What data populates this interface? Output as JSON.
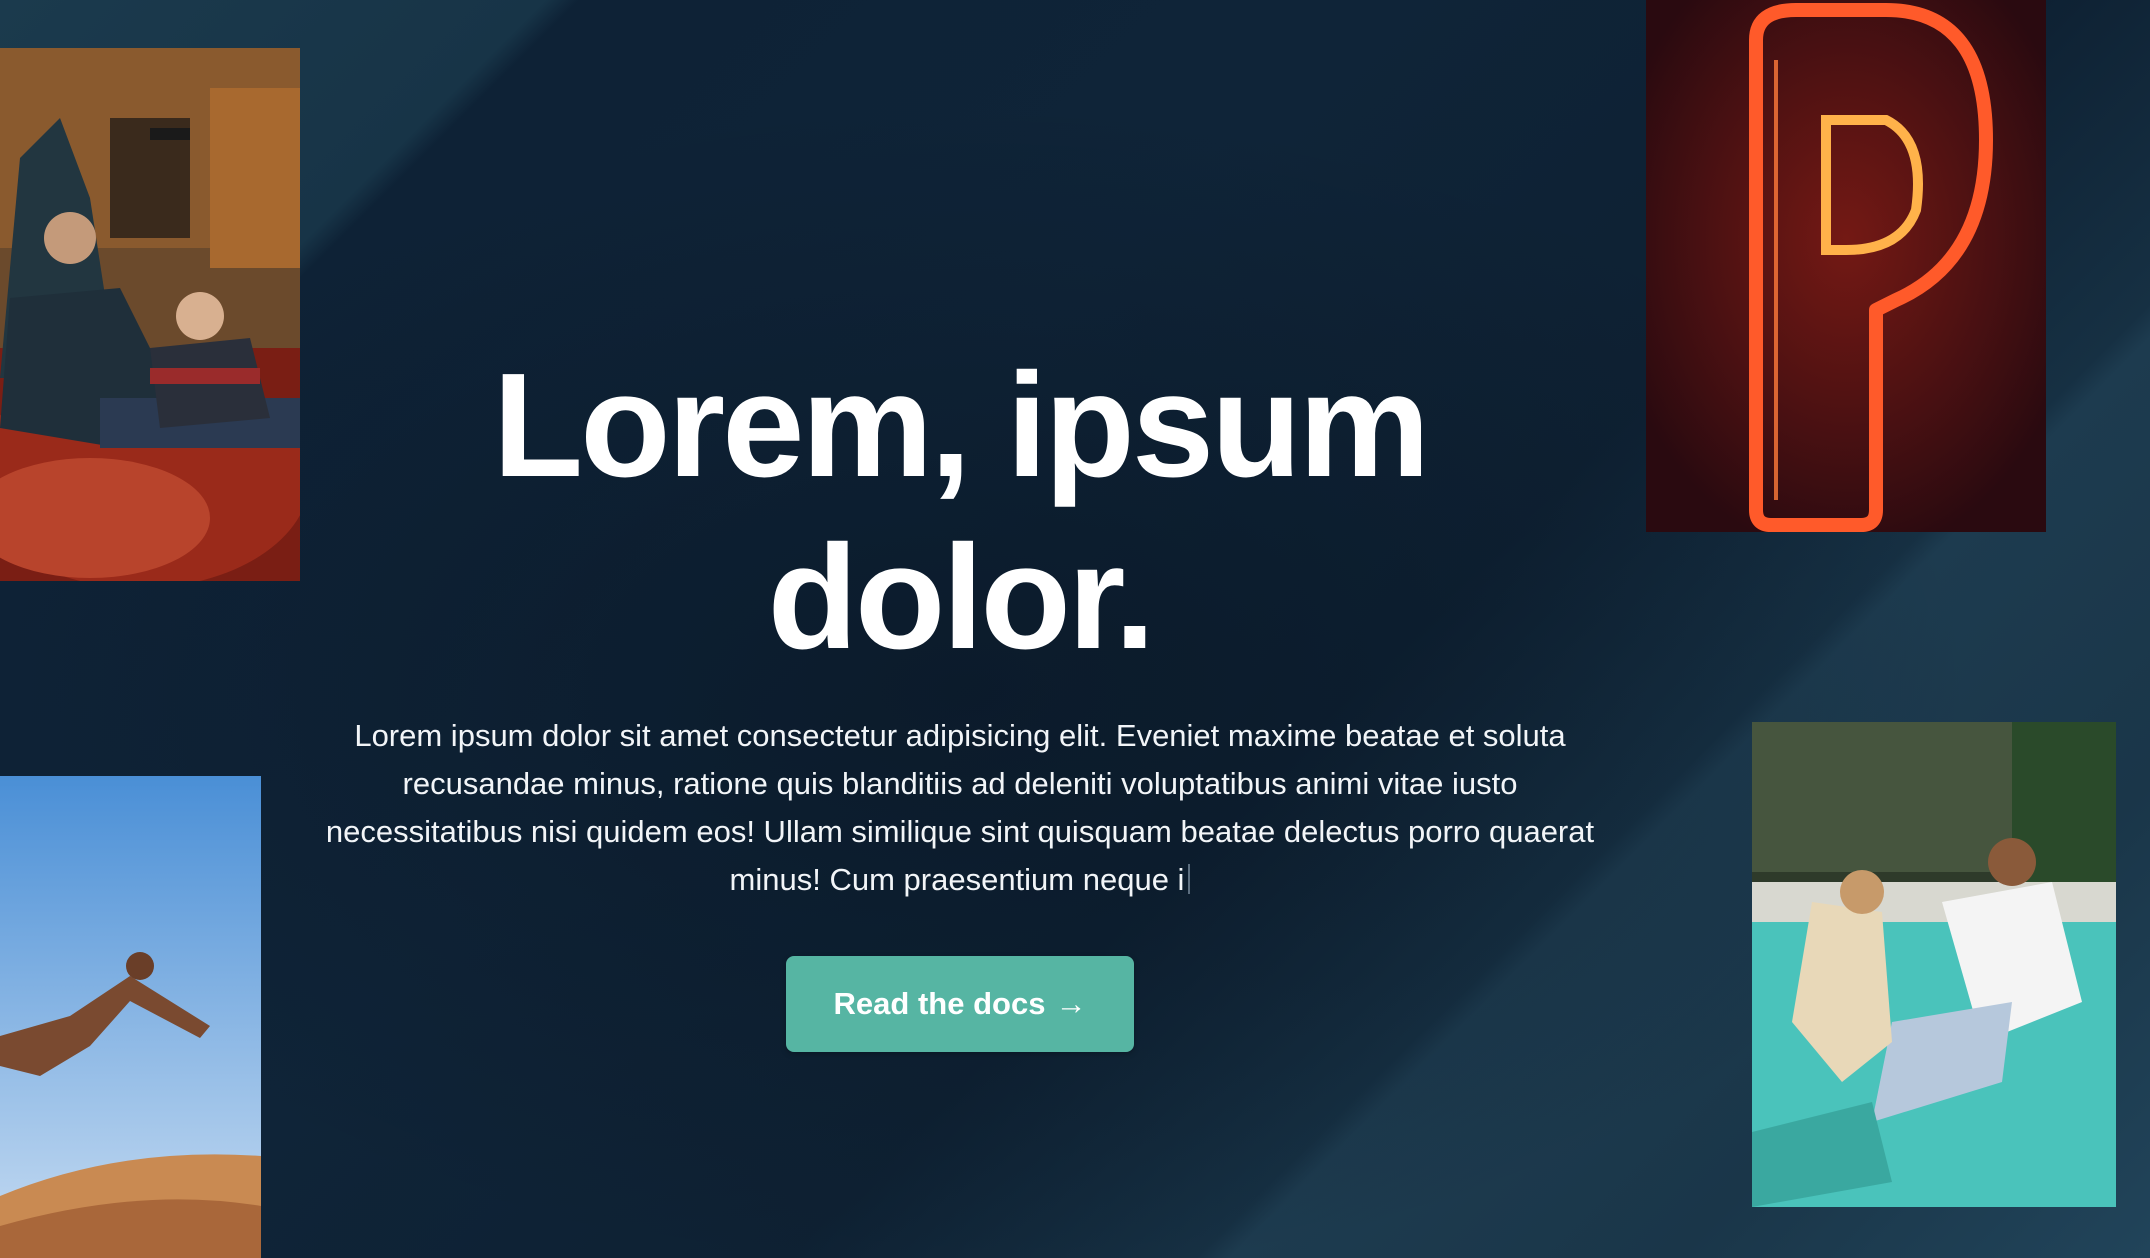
{
  "hero": {
    "headline": "Lorem, ipsum dolor.",
    "lead": "Lorem ipsum dolor sit amet consectetur adipisicing elit. Eveniet maxime beatae et soluta recusandae minus, ratione quis blanditiis ad deleniti voluptatibus animi vitae iusto necessitatibus nisi quidem eos! Ullam similique sint quisquam beatae delectus porro quaerat minus! Cum praesentium neque i",
    "cta_label": "Read the docs",
    "cta_arrow": "→"
  },
  "images": [
    {
      "name": "photo-gamers",
      "subject": "man and boy playing video games on red sofa"
    },
    {
      "name": "photo-neon",
      "subject": "red neon letter P"
    },
    {
      "name": "photo-jump",
      "subject": "man leaping over desert sand dune"
    },
    {
      "name": "photo-pool",
      "subject": "two people falling into a swimming pool"
    }
  ],
  "colors": {
    "background": "#0f2438",
    "accent": "#56b5a3",
    "text": "#ffffff"
  }
}
